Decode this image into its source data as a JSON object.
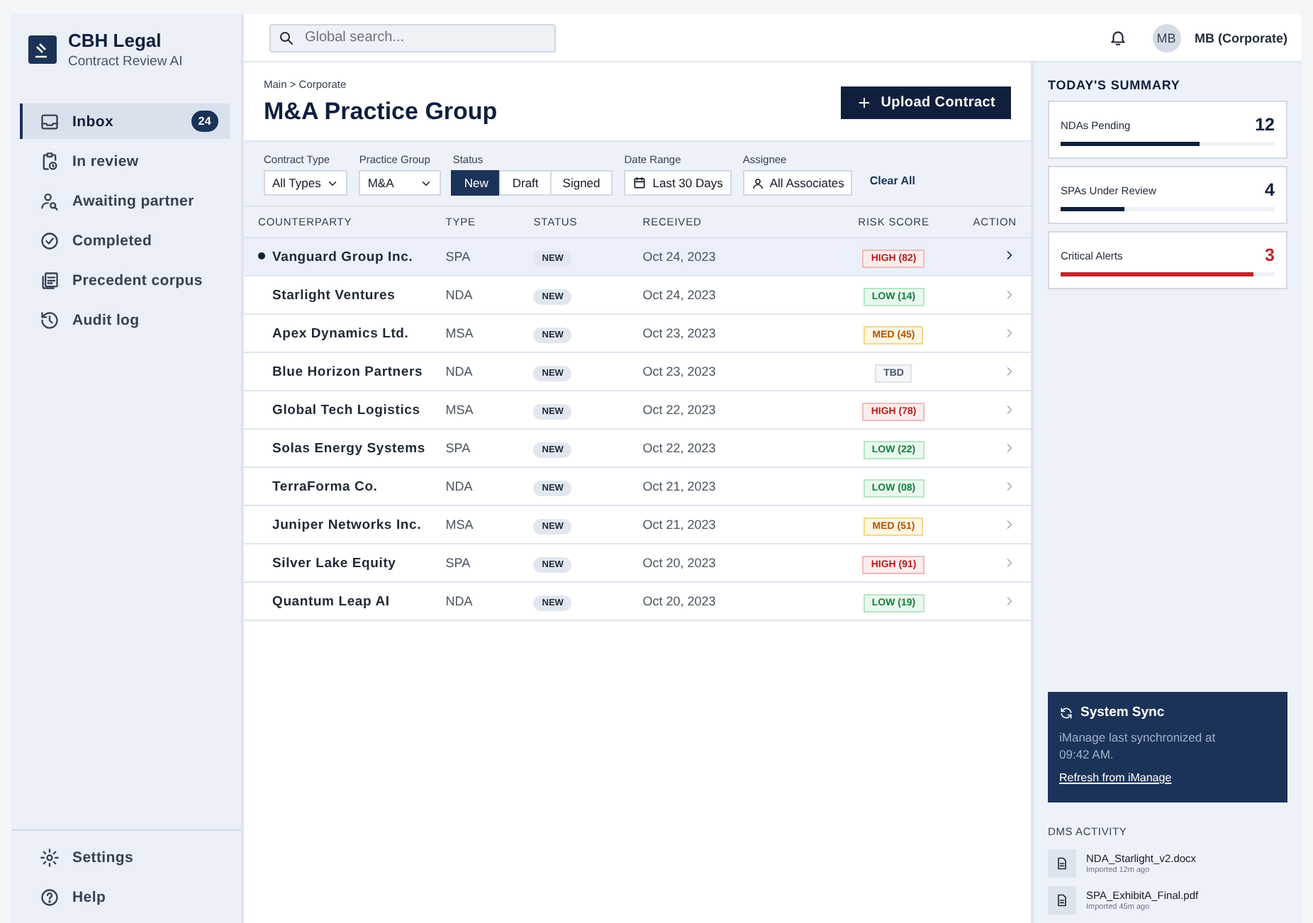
{
  "brand": {
    "name": "CBH Legal",
    "subtitle": "Contract Review AI"
  },
  "nav": [
    {
      "label": "Inbox",
      "selected": true,
      "badge": "24"
    },
    {
      "label": "In review",
      "selected": false
    },
    {
      "label": "Awaiting partner",
      "selected": false
    },
    {
      "label": "Completed",
      "selected": false
    },
    {
      "label": "Precedent corpus",
      "selected": false
    },
    {
      "label": "Audit log",
      "selected": false
    }
  ],
  "nav_bottom": [
    {
      "label": "Settings"
    },
    {
      "label": "Help"
    }
  ],
  "search": {
    "placeholder": "Global search..."
  },
  "user": {
    "avatar": "MB",
    "name": "MB (Corporate)"
  },
  "breadcrumb": "Main > Corporate",
  "page_title": "M&A Practice Group",
  "upload_button": "Upload Contract",
  "filters": [
    {
      "kind": "select",
      "label": "Contract Type",
      "value": "All Types"
    },
    {
      "kind": "select",
      "label": "Practice Group",
      "value": "M&A"
    },
    {
      "kind": "segmented",
      "label": "Status",
      "options": [
        {
          "label": "New",
          "selected": true
        },
        {
          "label": "Draft",
          "selected": false
        },
        {
          "label": "Signed",
          "selected": false
        }
      ]
    },
    {
      "kind": "date",
      "label": "Date Range",
      "value": "Last 30 Days"
    },
    {
      "kind": "person",
      "label": "Assignee",
      "value": "All Associates"
    }
  ],
  "clear_all": "Clear All",
  "table": {
    "columns": [
      "COUNTERPARTY",
      "TYPE",
      "STATUS",
      "RECEIVED",
      "RISK SCORE",
      "ACTION"
    ],
    "rows": [
      {
        "counterparty": "Vanguard Group Inc.",
        "type": "SPA",
        "status": "NEW",
        "received": "Oct 24, 2023",
        "risk": "HIGH (82)",
        "kind": "high",
        "selected": true
      },
      {
        "counterparty": "Starlight Ventures",
        "type": "NDA",
        "status": "NEW",
        "received": "Oct 24, 2023",
        "risk": "LOW (14)",
        "kind": "low",
        "selected": false
      },
      {
        "counterparty": "Apex Dynamics Ltd.",
        "type": "MSA",
        "status": "NEW",
        "received": "Oct 23, 2023",
        "risk": "MED (45)",
        "kind": "med",
        "selected": false
      },
      {
        "counterparty": "Blue Horizon Partners",
        "type": "NDA",
        "status": "NEW",
        "received": "Oct 23, 2023",
        "risk": "TBD",
        "kind": "tbd",
        "selected": false
      },
      {
        "counterparty": "Global Tech Logistics",
        "type": "MSA",
        "status": "NEW",
        "received": "Oct 22, 2023",
        "risk": "HIGH (78)",
        "kind": "high",
        "selected": false
      },
      {
        "counterparty": "Solas Energy Systems",
        "type": "SPA",
        "status": "NEW",
        "received": "Oct 22, 2023",
        "risk": "LOW (22)",
        "kind": "low",
        "selected": false
      },
      {
        "counterparty": "TerraForma Co.",
        "type": "NDA",
        "status": "NEW",
        "received": "Oct 21, 2023",
        "risk": "LOW (08)",
        "kind": "low",
        "selected": false
      },
      {
        "counterparty": "Juniper Networks Inc.",
        "type": "MSA",
        "status": "NEW",
        "received": "Oct 21, 2023",
        "risk": "MED (51)",
        "kind": "med",
        "selected": false
      },
      {
        "counterparty": "Silver Lake Equity",
        "type": "SPA",
        "status": "NEW",
        "received": "Oct 20, 2023",
        "risk": "HIGH (91)",
        "kind": "high",
        "selected": false
      },
      {
        "counterparty": "Quantum Leap AI",
        "type": "NDA",
        "status": "NEW",
        "received": "Oct 20, 2023",
        "risk": "LOW (19)",
        "kind": "low",
        "selected": false
      }
    ]
  },
  "summary": {
    "title": "TODAY'S SUMMARY",
    "cards": [
      {
        "label": "NDAs Pending",
        "value": "12",
        "level": 0.65,
        "kind": "normal"
      },
      {
        "label": "SPAs Under Review",
        "value": "4",
        "level": 0.3,
        "kind": "normal"
      },
      {
        "label": "Critical Alerts",
        "value": "3",
        "level": 0.9,
        "kind": "alert"
      }
    ]
  },
  "sync": {
    "title": "System Sync",
    "text": "iManage last synchronized at 09:42 AM.",
    "link": "Refresh from iManage"
  },
  "dms": {
    "title": "DMS ACTIVITY",
    "items": [
      {
        "file": "NDA_Starlight_v2.docx",
        "time": "Imported 12m ago"
      },
      {
        "file": "SPA_ExhibitA_Final.pdf",
        "time": "Imported 45m ago"
      }
    ]
  }
}
